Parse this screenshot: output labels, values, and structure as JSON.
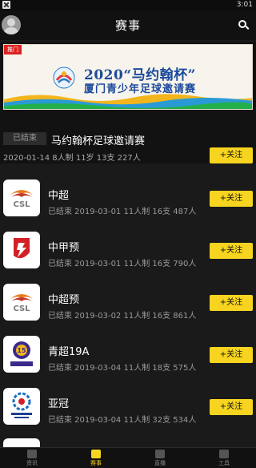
{
  "status_bar": {
    "time": "3:01"
  },
  "header": {
    "title": "赛事",
    "search_icon": "search-icon",
    "avatar_icon": "user-avatar-icon"
  },
  "featured": {
    "banner_tag": "推门",
    "banner_line1": "2020“马约翰杯”",
    "banner_line2": "厦门青少年足球邀请赛",
    "status": "已结束",
    "name": "马约翰杯足球邀请赛",
    "detail": "2020-01-14 8人制 11岁 13支 227人",
    "follow_label": "+关注"
  },
  "matches": [
    {
      "name": "中超",
      "detail": "已结束 2019-03-01 11人制 16支 487人",
      "follow_label": "+关注",
      "logo": "csl-logo"
    },
    {
      "name": "中甲预",
      "detail": "已结束 2019-03-01 11人制 16支 790人",
      "follow_label": "+关注",
      "logo": "china-league-one-logo"
    },
    {
      "name": "中超预",
      "detail": "已结束 2019-03-02 11人制 16支 861人",
      "follow_label": "+关注",
      "logo": "csl-logo"
    },
    {
      "name": "青超19A",
      "detail": "已结束 2019-03-04 11人制 18支 575人",
      "follow_label": "+关注",
      "logo": "youth-super-league-logo"
    },
    {
      "name": "亚冠",
      "detail": "已结束 2019-03-04 11人制 32支 534人",
      "follow_label": "+关注",
      "logo": "afc-champions-league-logo"
    }
  ],
  "tabs": [
    {
      "label": "资讯",
      "icon": "news-icon",
      "active": false
    },
    {
      "label": "赛事",
      "icon": "match-icon",
      "active": true
    },
    {
      "label": "直播",
      "icon": "live-icon",
      "active": false
    },
    {
      "label": "工具",
      "icon": "tools-icon",
      "active": false
    }
  ],
  "colors": {
    "accent": "#f7d41f",
    "background": "#1a1a1a",
    "header": "#111111"
  }
}
